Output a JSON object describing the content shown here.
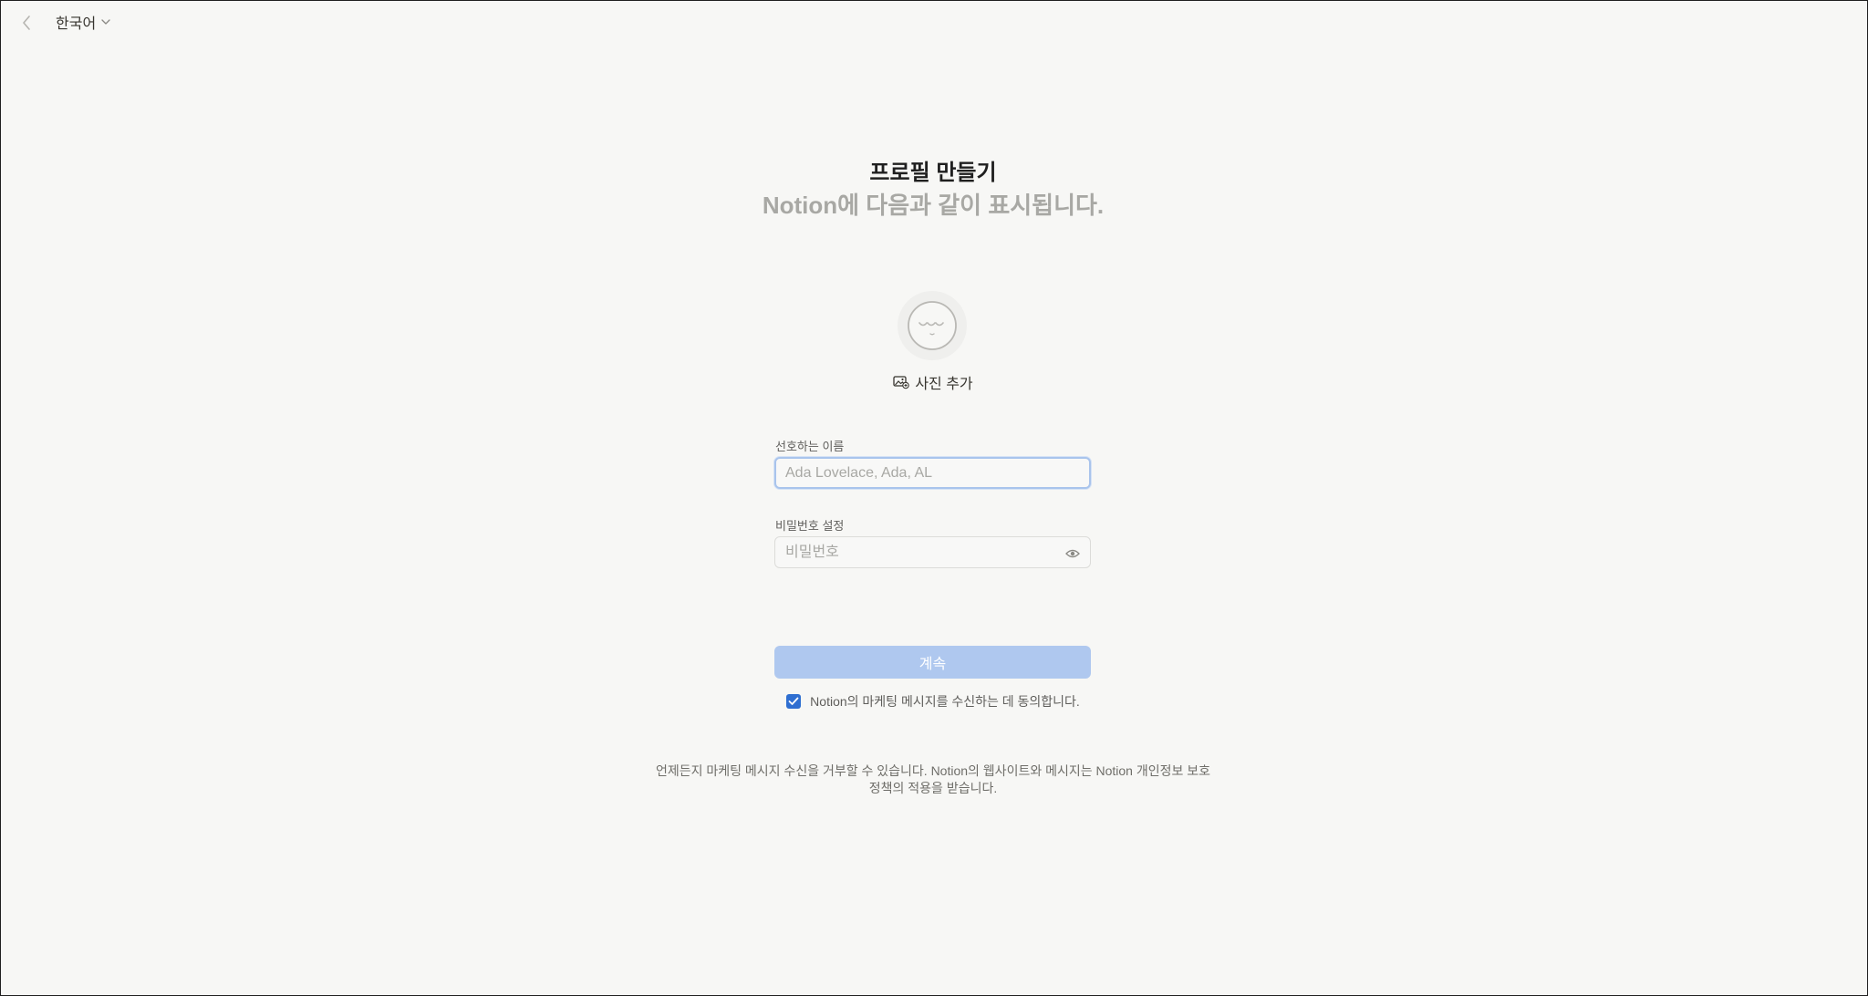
{
  "topbar": {
    "back_icon": "chevron-left-icon",
    "language_label": "한국어",
    "language_icon": "chevron-down-icon"
  },
  "header": {
    "title": "프로필 만들기",
    "subtitle": "Notion에 다음과 같이 표시됩니다."
  },
  "avatar": {
    "icon": "face-avatar-icon",
    "add_photo_label": "사진 추가",
    "add_photo_icon": "image-add-icon"
  },
  "form": {
    "name_label": "선호하는 이름",
    "name_placeholder": "Ada Lovelace, Ada, AL",
    "name_value": "",
    "password_label": "비밀번호 설정",
    "password_placeholder": "비밀번호",
    "password_value": "",
    "password_toggle_icon": "eye-icon",
    "continue_label": "계속",
    "marketing_consent_label": "Notion의 마케팅 메시지를 수신하는 데 동의합니다.",
    "marketing_consent_checked": true
  },
  "footer": {
    "note": "언제든지 마케팅 메시지 수신을 거부할 수 있습니다. Notion의 웹사이트와 메시지는 Notion 개인정보 보호정책의 적용을 받습니다."
  },
  "colors": {
    "background": "#f7f7f5",
    "primary_disabled": "#afc8ef",
    "checkbox_accent": "#2f6fd1",
    "focus_ring": "#a9c4ec"
  }
}
